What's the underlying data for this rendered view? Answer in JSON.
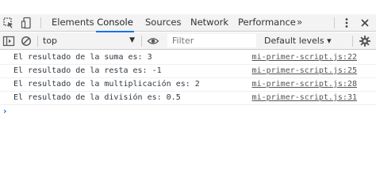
{
  "tabs": [
    {
      "label": "Elements",
      "active": false
    },
    {
      "label": "Console",
      "active": true
    },
    {
      "label": "Sources",
      "active": false
    },
    {
      "label": "Network",
      "active": false
    },
    {
      "label": "Performance",
      "active": false
    }
  ],
  "toolbar": {
    "more_tabs_glyph": "»",
    "icons": [
      "inspect-element-icon",
      "device-toggle-icon",
      "kebab-menu-icon",
      "close-icon"
    ]
  },
  "filterbar": {
    "context": "top",
    "filter_placeholder": "Filter",
    "levels": "Default levels ▾",
    "icons": [
      "sidebar-toggle-icon",
      "clear-console-icon",
      "eye-icon",
      "settings-gear-icon"
    ]
  },
  "console": {
    "messages": [
      {
        "text": "El resultado de la suma es: 3",
        "source": "mi-primer-script.js:22"
      },
      {
        "text": "El resultado de la resta es: -1",
        "source": "mi-primer-script.js:25"
      },
      {
        "text": "El resultado de la multiplicación es: 2",
        "source": "mi-primer-script.js:28"
      },
      {
        "text": "El resultado de la división es: 0.5",
        "source": "mi-primer-script.js:31"
      }
    ],
    "prompt_glyph": "›"
  },
  "colors": {
    "accent": "#1a73e8",
    "toolbar_bg": "#f3f3f3",
    "border": "#cccccc"
  }
}
